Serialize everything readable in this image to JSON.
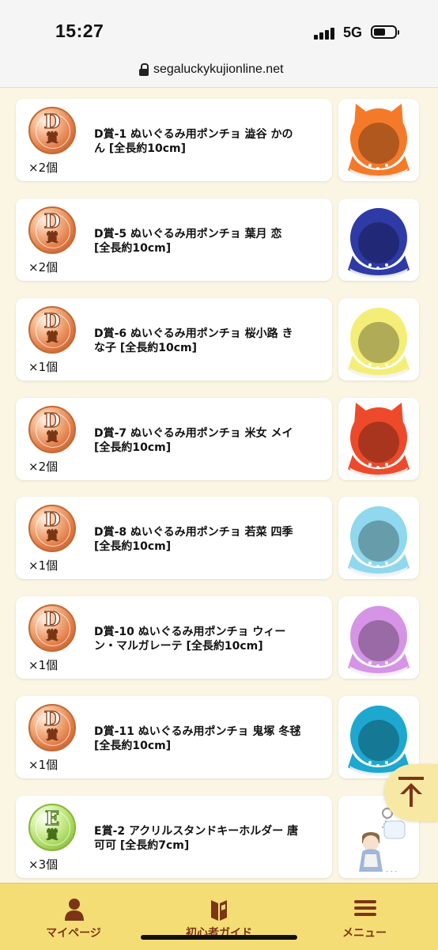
{
  "status_bar": {
    "time": "15:27",
    "network": "5G"
  },
  "browser": {
    "url": "segaluckykujionline.net"
  },
  "prizes": [
    {
      "grade": "D",
      "grade_suffix": "賞",
      "title": "D賞-1 ぬいぐるみ用ポンチョ 澁谷 かのん [全長約10cm]",
      "quantity": "×2個",
      "image": "orange-cat-ear-poncho",
      "color": "#f47a2a"
    },
    {
      "grade": "D",
      "grade_suffix": "賞",
      "title": "D賞-5 ぬいぐるみ用ポンチョ 葉月 恋 [全長約10cm]",
      "quantity": "×2個",
      "image": "navy-hood-poncho",
      "color": "#2e3aa6"
    },
    {
      "grade": "D",
      "grade_suffix": "賞",
      "title": "D賞-6 ぬいぐるみ用ポンチョ 桜小路 きな子 [全長約10cm]",
      "quantity": "×1個",
      "image": "yellow-hood-poncho",
      "color": "#f4ee78"
    },
    {
      "grade": "D",
      "grade_suffix": "賞",
      "title": "D賞-7 ぬいぐるみ用ポンチョ 米女 メイ [全長約10cm]",
      "quantity": "×2個",
      "image": "red-cat-ear-poncho",
      "color": "#ec4a2b"
    },
    {
      "grade": "D",
      "grade_suffix": "賞",
      "title": "D賞-8 ぬいぐるみ用ポンチョ 若菜 四季 [全長約10cm]",
      "quantity": "×1個",
      "image": "light-blue-hood-poncho",
      "color": "#8fd8ee"
    },
    {
      "grade": "D",
      "grade_suffix": "賞",
      "title": "D賞-10 ぬいぐるみ用ポンチョ ウィーン・マルガレーテ [全長約10cm]",
      "quantity": "×1個",
      "image": "lavender-hood-poncho",
      "color": "#d594e6"
    },
    {
      "grade": "D",
      "grade_suffix": "賞",
      "title": "D賞-11 ぬいぐるみ用ポンチョ 鬼塚 冬毬 [全長約10cm]",
      "quantity": "×1個",
      "image": "teal-hood-poncho",
      "color": "#1ea8cf"
    },
    {
      "grade": "E",
      "grade_suffix": "賞",
      "title": "E賞-2 アクリルスタンドキーホルダー 唐 可可 [全長約7cm]",
      "quantity": "×3個",
      "image": "acrylic-keychain",
      "color": "#9fb7d8"
    }
  ],
  "scroll_to_top": {
    "icon": "arrow-up-icon"
  },
  "bottom_nav": [
    {
      "label": "マイページ",
      "icon": "person-icon"
    },
    {
      "label": "初心者ガイド",
      "icon": "guide-book-icon"
    },
    {
      "label": "メニュー",
      "icon": "hamburger-menu-icon"
    }
  ],
  "colors": {
    "background": "#fbf6e4",
    "nav_background": "#f5dd76",
    "nav_text": "#7b3616",
    "medal_d": "#e07a45",
    "medal_e": "#a7d75a"
  }
}
